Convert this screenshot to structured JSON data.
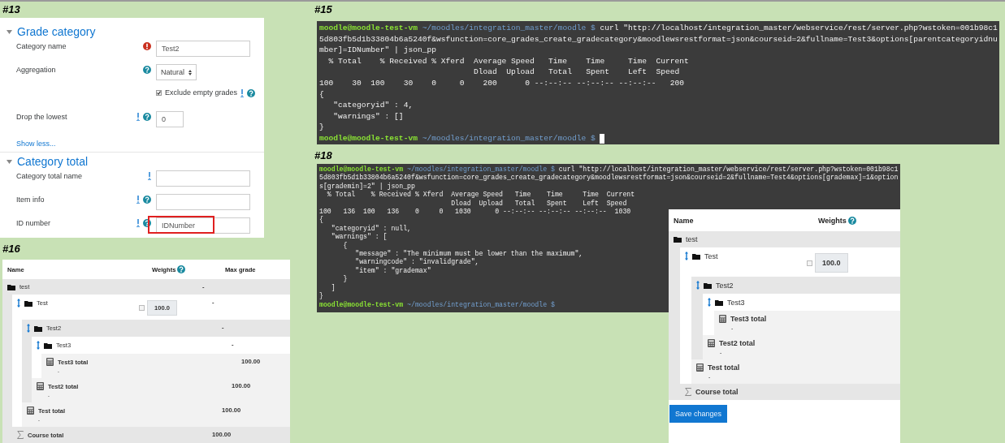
{
  "form_panel": {
    "label": "#13",
    "sections": [
      {
        "title": "Grade category",
        "expanded": true,
        "fields": [
          {
            "kind": "text",
            "label": "Category name",
            "advanced": false,
            "required": true,
            "help": false,
            "value": "Test2"
          },
          {
            "kind": "select",
            "label": "Aggregation",
            "advanced": false,
            "required": false,
            "help": true,
            "value": "Natural"
          },
          {
            "kind": "checkbox",
            "label": "Exclude empty grades",
            "checked": true,
            "advanced": true,
            "required": false,
            "help": true
          },
          {
            "kind": "number",
            "label": "Drop the lowest",
            "advanced": true,
            "required": false,
            "help": true,
            "value": "0"
          }
        ],
        "link": "Show less..."
      },
      {
        "title": "Category total",
        "expanded": true,
        "fields": [
          {
            "kind": "text",
            "label": "Category total name",
            "advanced": true,
            "required": false,
            "help": false
          },
          {
            "kind": "text",
            "label": "Item info",
            "advanced": true,
            "required": false,
            "help": true
          },
          {
            "kind": "text",
            "label": "ID number",
            "advanced": true,
            "required": false,
            "help": true,
            "value": "IDNumber",
            "highlighted": true
          }
        ]
      }
    ]
  },
  "terminals": [
    {
      "label": "#15",
      "cursor": true,
      "lines": [
        {
          "kind": "prompt",
          "user": "moodle@moodle-test-vm",
          "path": "~/moodles/integration_master/moodle $",
          "command": "curl \"http://localhost/integration_master/webservice/rest/server.php?wstoken=001b98c1"
        },
        {
          "kind": "output",
          "text": "5d803fb5d1b33804b6a5240f&wsfunction=core_grades_create_gradecategory&moodlewsrestformat=json&courseid=2&fullname=Test3&options[parentcategoryidnu"
        },
        {
          "kind": "output",
          "text": "mber]=IDNumber\" | json_pp"
        },
        {
          "kind": "output",
          "text": "  % Total    % Received % Xferd  Average Speed   Time    Time     Time  Current"
        },
        {
          "kind": "output",
          "text": "                                 Dload  Upload   Total   Spent    Left  Speed"
        },
        {
          "kind": "output",
          "text": "100    30  100    30    0     0    200      0 --:--:-- --:--:-- --:--:--   200"
        },
        {
          "kind": "output",
          "text": "{"
        },
        {
          "kind": "output",
          "text": "   \"categoryid\" : 4,"
        },
        {
          "kind": "output",
          "text": "   \"warnings\" : []"
        },
        {
          "kind": "output",
          "text": "}"
        },
        {
          "kind": "prompt",
          "user": "moodle@moodle-test-vm",
          "path": "~/moodles/integration_master/moodle $"
        }
      ]
    },
    {
      "label": "#18",
      "cursor": false,
      "lines": [
        {
          "kind": "prompt",
          "user": "moodle@moodle-test-vm",
          "path": "~/moodles/integration_master/moodle $",
          "command": "curl \"http://localhost/integration_master/webservice/rest/server.php?wstoken=001b98c1"
        },
        {
          "kind": "output",
          "text": "5d803fb5d1b33804b6a5240f&wsfunction=core_grades_create_gradecategory&moodlewsrestformat=json&courseid=2&fullname=Test4&options[grademax]=1&option"
        },
        {
          "kind": "output",
          "text": "s[grademin]=2\" | json_pp"
        },
        {
          "kind": "output",
          "text": "  % Total    % Received % Xferd  Average Speed   Time    Time     Time  Current"
        },
        {
          "kind": "output",
          "text": "                                 Dload  Upload   Total   Spent    Left  Speed"
        },
        {
          "kind": "output",
          "text": "100   136  100   136    0     0   1030      0 --:--:-- --:--:-- --:--:--  1030"
        },
        {
          "kind": "output",
          "text": "{"
        },
        {
          "kind": "output",
          "text": "   \"categoryid\" : null,"
        },
        {
          "kind": "output",
          "text": "   \"warnings\" : ["
        },
        {
          "kind": "output",
          "text": "      {"
        },
        {
          "kind": "output",
          "text": "         \"message\" : \"The minimum must be lower than the maximum\","
        },
        {
          "kind": "output",
          "text": "         \"warningcode\" : \"invalidgrade\","
        },
        {
          "kind": "output",
          "text": "         \"item\" : \"grademax\""
        },
        {
          "kind": "output",
          "text": "      }"
        },
        {
          "kind": "output",
          "text": "   ]"
        },
        {
          "kind": "output",
          "text": "}"
        },
        {
          "kind": "prompt",
          "user": "moodle@moodle-test-vm",
          "path": "~/moodles/integration_master/moodle $"
        }
      ]
    }
  ],
  "grade_trees": [
    {
      "label": "#16",
      "columns": [
        "Name",
        "Weights",
        "Max grade"
      ],
      "rows": [
        {
          "kind": "category",
          "name": "test",
          "movable": false,
          "max_grade": "-",
          "children": [
            {
              "kind": "category",
              "name": "Test",
              "movable": true,
              "weight": "100.0",
              "weight_checked": false,
              "max_grade": "-",
              "children": [
                {
                  "kind": "category",
                  "name": "Test2",
                  "movable": true,
                  "max_grade": "-",
                  "children": [
                    {
                      "kind": "category",
                      "name": "Test3",
                      "movable": true,
                      "max_grade": "-",
                      "children": [
                        {
                          "kind": "total",
                          "name": "Test3 total",
                          "note": "-",
                          "max_grade": "100.00"
                        }
                      ]
                    },
                    {
                      "kind": "total",
                      "name": "Test2 total",
                      "note": "-",
                      "max_grade": "100.00"
                    }
                  ]
                },
                {
                  "kind": "total",
                  "name": "Test total",
                  "note": "-",
                  "max_grade": "100.00"
                }
              ]
            },
            {
              "kind": "course_total",
              "name": "Course total",
              "max_grade": "100.00"
            }
          ]
        }
      ]
    },
    {
      "columns": [
        "Name",
        "Weights"
      ],
      "button": "Save changes",
      "rows": [
        {
          "kind": "category",
          "name": "test",
          "movable": false,
          "children": [
            {
              "kind": "category",
              "name": "Test",
              "movable": true,
              "weight": "100.0",
              "weight_checked": false,
              "children": [
                {
                  "kind": "category",
                  "name": "Test2",
                  "movable": true,
                  "children": [
                    {
                      "kind": "category",
                      "name": "Test3",
                      "movable": true,
                      "children": [
                        {
                          "kind": "total",
                          "name": "Test3 total",
                          "note": "-"
                        }
                      ]
                    },
                    {
                      "kind": "total",
                      "name": "Test2 total",
                      "note": "-"
                    }
                  ]
                },
                {
                  "kind": "total",
                  "name": "Test total",
                  "note": "-"
                }
              ]
            },
            {
              "kind": "course_total",
              "name": "Course total"
            }
          ]
        }
      ]
    }
  ]
}
